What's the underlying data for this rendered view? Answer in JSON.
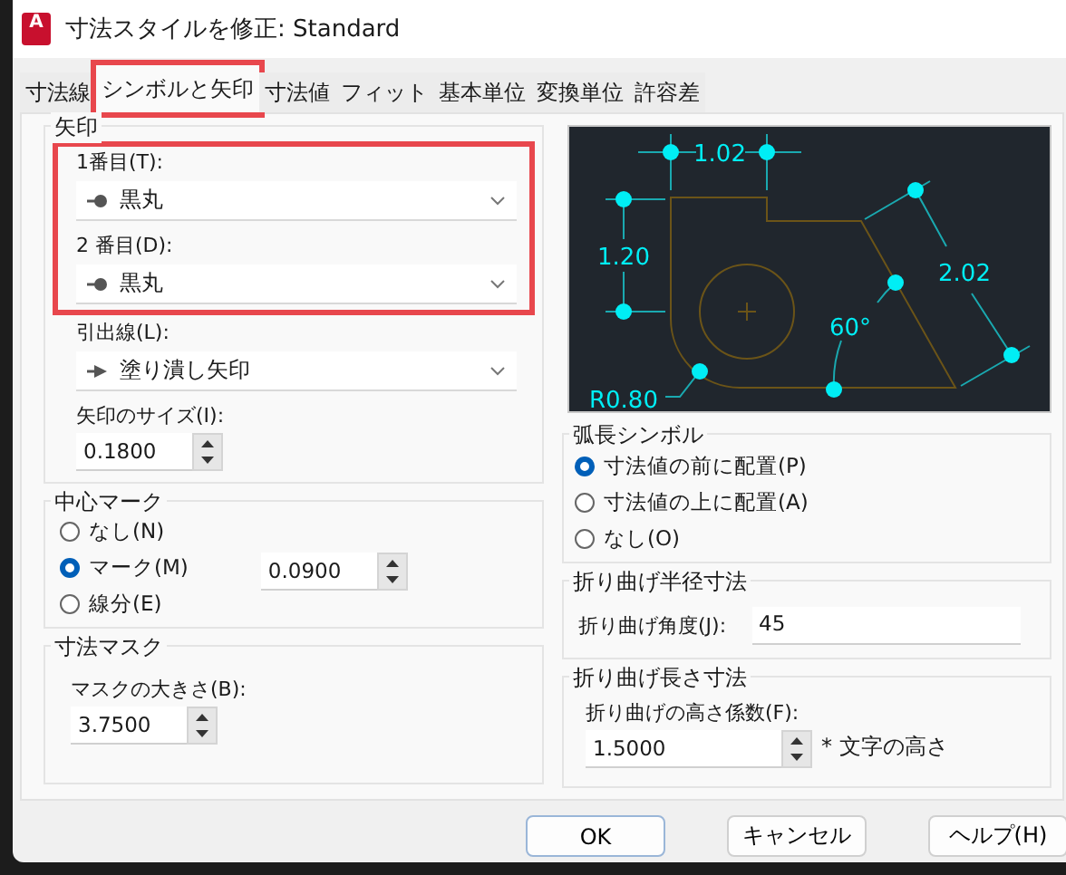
{
  "window": {
    "logo_text": "A",
    "title": "寸法スタイルを修正: Standard"
  },
  "tabs": [
    {
      "label": "寸法線",
      "selected": false,
      "highlighted": false
    },
    {
      "label": "シンボルと矢印",
      "selected": true,
      "highlighted": true
    },
    {
      "label": "寸法値",
      "selected": false,
      "highlighted": false
    },
    {
      "label": "フィット",
      "selected": false,
      "highlighted": false
    },
    {
      "label": "基本単位",
      "selected": false,
      "highlighted": false
    },
    {
      "label": "変換単位",
      "selected": false,
      "highlighted": false
    },
    {
      "label": "許容差",
      "selected": false,
      "highlighted": false
    }
  ],
  "arrowheads": {
    "title": "矢印",
    "highlighted": true,
    "first": {
      "label": "1番目(T):",
      "value": "黒丸",
      "kind": "dot"
    },
    "second": {
      "label": "2 番目(D):",
      "value": "黒丸",
      "kind": "dot"
    },
    "leader": {
      "label": "引出線(L):",
      "value": "塗り潰し矢印",
      "kind": "arrow"
    },
    "size": {
      "label": "矢印のサイズ(I):",
      "value": "0.1800"
    }
  },
  "center_marks": {
    "title": "中心マーク",
    "options": [
      {
        "label": "なし(N)",
        "selected": false
      },
      {
        "label": "マーク(M)",
        "selected": true
      },
      {
        "label": "線分(E)",
        "selected": false
      }
    ],
    "size": {
      "value": "0.0900"
    }
  },
  "dimension_mask": {
    "title": "寸法マスク",
    "size": {
      "label": "マスクの大きさ(B):",
      "value": "3.7500"
    }
  },
  "preview": {
    "labels": [
      "1.02",
      "1.20",
      "2.02",
      "60°",
      "R0.80"
    ]
  },
  "arc_length_symbol": {
    "title": "弧長シンボル",
    "options": [
      {
        "label": "寸法値の前に配置(P)",
        "selected": true
      },
      {
        "label": "寸法値の上に配置(A)",
        "selected": false
      },
      {
        "label": "なし(O)",
        "selected": false
      }
    ]
  },
  "radius_jog": {
    "title": "折り曲げ半径寸法",
    "angle": {
      "label": "折り曲げ角度(J):",
      "value": "45"
    }
  },
  "linear_jog": {
    "title": "折り曲げ長さ寸法",
    "height": {
      "label": "折り曲げの高さ係数(F):",
      "value": "1.5000",
      "suffix": "* 文字の高さ"
    }
  },
  "buttons": [
    {
      "label": "OK",
      "default": true
    },
    {
      "label": "キャンセル",
      "default": false
    },
    {
      "label": "ヘルプ(H)",
      "default": false
    }
  ]
}
